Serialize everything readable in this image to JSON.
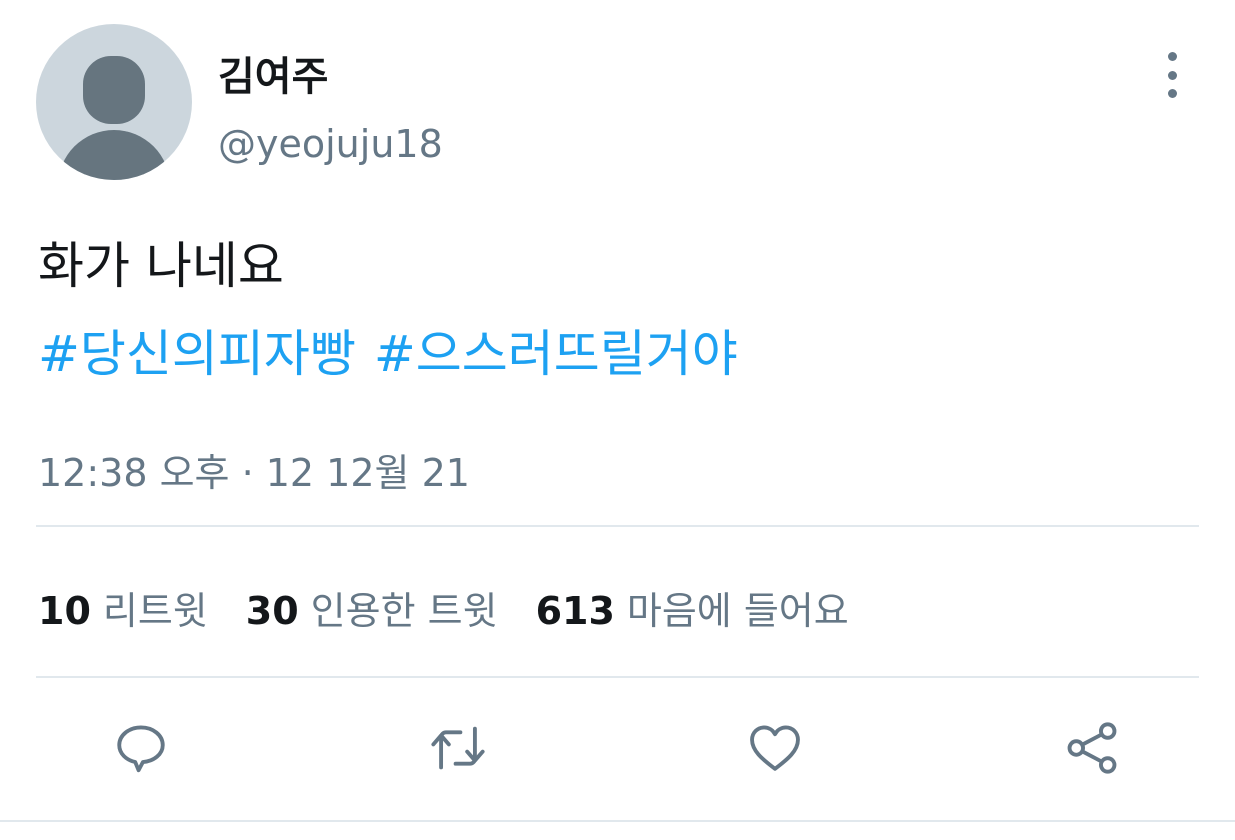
{
  "tweet": {
    "author": {
      "display_name": "김여주",
      "handle": "@yeojuju18"
    },
    "text": "화가 나네요",
    "hashtags": [
      "#당신의피자빵",
      "#으스러뜨릴거야"
    ],
    "timestamp": "12:38 오후 · 12 12월 21",
    "stats": [
      {
        "count": "10",
        "label": "리트윗"
      },
      {
        "count": "30",
        "label": "인용한 트윗"
      },
      {
        "count": "613",
        "label": "마음에 들어요"
      }
    ]
  },
  "icons": {
    "more": "more-vertical-icon",
    "reply": "reply-icon",
    "retweet": "retweet-icon",
    "like": "heart-icon",
    "share": "share-icon"
  },
  "colors": {
    "hashtag": "#1da1f2",
    "secondary_text": "#657786",
    "divider": "#e1e8ed",
    "avatar_bg": "#ccd6dd",
    "avatar_fg": "#66757f"
  }
}
